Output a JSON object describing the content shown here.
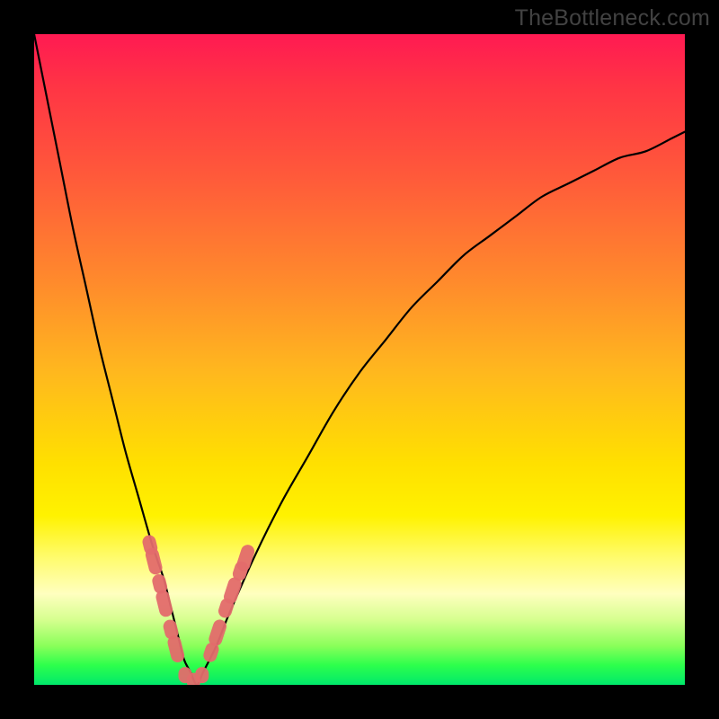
{
  "watermark": "TheBottleneck.com",
  "chart_data": {
    "type": "line",
    "title": "",
    "xlabel": "",
    "ylabel": "",
    "xlim": [
      0,
      100
    ],
    "ylim": [
      0,
      100
    ],
    "series": [
      {
        "name": "bottleneck-curve",
        "x": [
          0,
          2,
          4,
          6,
          8,
          10,
          12,
          14,
          16,
          18,
          19,
          20,
          21,
          22,
          23,
          24,
          25,
          26,
          28,
          30,
          34,
          38,
          42,
          46,
          50,
          54,
          58,
          62,
          66,
          70,
          74,
          78,
          82,
          86,
          90,
          94,
          98,
          100
        ],
        "y": [
          100,
          90,
          80,
          70,
          61,
          52,
          44,
          36,
          29,
          22,
          19,
          16,
          12,
          8,
          4,
          2,
          0,
          2,
          6,
          11,
          20,
          28,
          35,
          42,
          48,
          53,
          58,
          62,
          66,
          69,
          72,
          75,
          77,
          79,
          81,
          82,
          84,
          85
        ]
      }
    ],
    "markers": {
      "left_arm": [
        {
          "x": 17.8,
          "y": 21.5
        },
        {
          "x": 18.4,
          "y": 19.0
        },
        {
          "x": 19.3,
          "y": 15.5
        },
        {
          "x": 20.0,
          "y": 12.5
        },
        {
          "x": 21.0,
          "y": 8.5
        },
        {
          "x": 21.8,
          "y": 5.5
        }
      ],
      "bottom": [
        {
          "x": 23.2,
          "y": 1.5
        },
        {
          "x": 24.5,
          "y": 0.6
        },
        {
          "x": 25.8,
          "y": 1.5
        }
      ],
      "right_arm": [
        {
          "x": 27.2,
          "y": 5.0
        },
        {
          "x": 28.2,
          "y": 8.0
        },
        {
          "x": 29.5,
          "y": 11.8
        },
        {
          "x": 30.5,
          "y": 14.5
        },
        {
          "x": 31.7,
          "y": 17.5
        },
        {
          "x": 32.5,
          "y": 19.5
        }
      ]
    },
    "colors": {
      "curve": "#000000",
      "marker_fill": "#e36b6b",
      "gradient_top": "#ff1a52",
      "gradient_bottom": "#00e86b"
    }
  }
}
